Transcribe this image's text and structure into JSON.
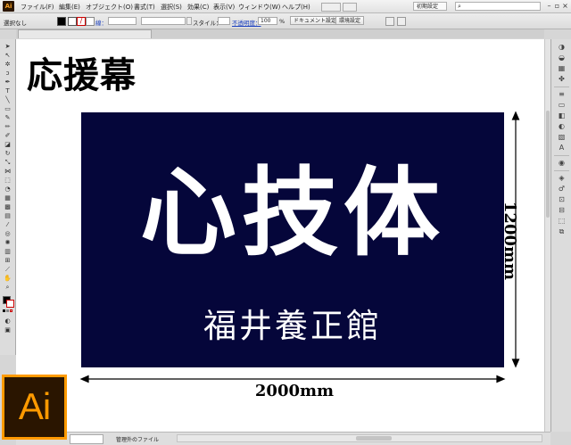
{
  "app": {
    "logo_text": "Ai",
    "menus": [
      "ファイル(F)",
      "編集(E)",
      "オブジェクト(O)",
      "書式(T)",
      "選択(S)",
      "効果(C)",
      "表示(V)",
      "ウィンドウ(W)",
      "ヘルプ(H)"
    ],
    "workspace": "初期設定",
    "search_placeholder": ""
  },
  "controlbar": {
    "selection_status": "選択なし",
    "stroke_label": "線：",
    "style_label": "スタイル：",
    "opacity_label": "不透明度：",
    "opacity_value": "100",
    "opacity_unit": "%",
    "document_setup_label": "ドキュメント設定",
    "preferences_label": "環境設定"
  },
  "document": {
    "tab_title": ""
  },
  "artboard": {
    "title": "応援幕",
    "banner": {
      "main_text": "心技体",
      "sub_text": "福井養正館",
      "background_color": "#05063a",
      "text_color": "#ffffff"
    },
    "width_label": "2000mm",
    "height_label": "1200mm"
  },
  "statusbar": {
    "status_text": "管理外のファイル"
  },
  "overlay": {
    "logo_text": "Ai",
    "accent_color": "#ff9a00"
  }
}
